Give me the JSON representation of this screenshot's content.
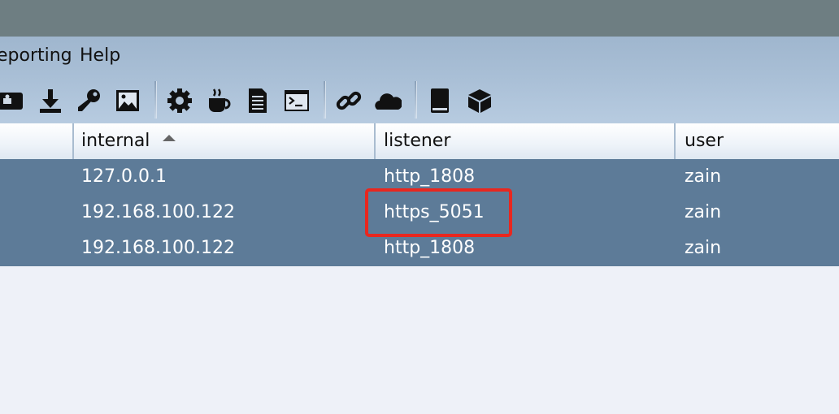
{
  "menu": {
    "items": [
      {
        "label": "eporting"
      },
      {
        "label": "Help"
      }
    ]
  },
  "toolbar": {
    "icons": [
      "vcard-icon",
      "download-icon",
      "key-icon",
      "image-icon",
      "gear-icon",
      "coffee-icon",
      "document-icon",
      "terminal-icon",
      "link-icon",
      "cloud-icon",
      "book-icon",
      "package-icon"
    ]
  },
  "table": {
    "columns": [
      {
        "label": ""
      },
      {
        "label": "internal",
        "sorted": "ascending"
      },
      {
        "label": "listener"
      },
      {
        "label": "user"
      }
    ],
    "rows": [
      {
        "internal": "127.0.0.1",
        "listener": "http_1808",
        "user": "zain"
      },
      {
        "internal": "192.168.100.122",
        "listener": "https_5051",
        "user": "zain"
      },
      {
        "internal": "192.168.100.122",
        "listener": "http_1808",
        "user": "zain"
      }
    ],
    "selection_color": "#5d7b98"
  },
  "annotation": {
    "color": "#e8271f",
    "target": "table.rows.1.listener"
  }
}
